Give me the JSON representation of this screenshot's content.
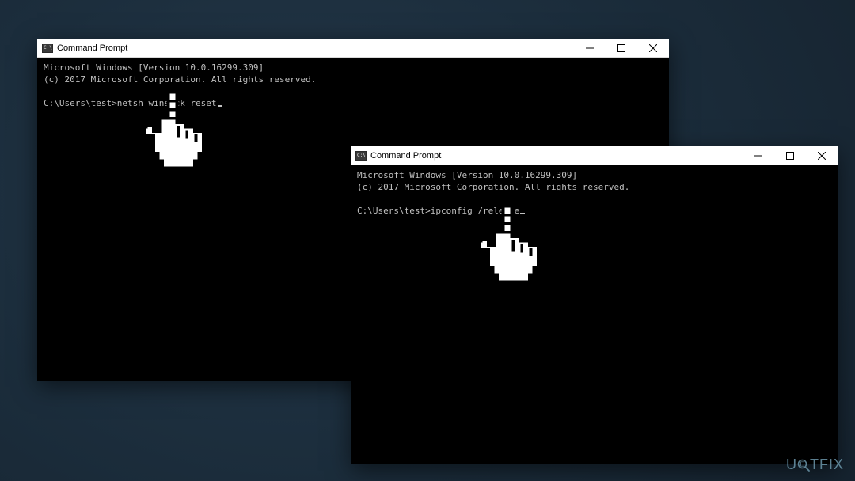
{
  "background": {
    "watermark_prefix": "U",
    "watermark_mid": "G",
    "watermark_suffix": "TFIX"
  },
  "windows": {
    "back": {
      "title": "Command Prompt",
      "output": {
        "line1": "Microsoft Windows [Version 10.0.16299.309]",
        "line2": "(c) 2017 Microsoft Corporation. All rights reserved."
      },
      "prompt": "C:\\Users\\test>",
      "command": "netsh winsock reset"
    },
    "front": {
      "title": "Command Prompt",
      "output": {
        "line1": "Microsoft Windows [Version 10.0.16299.309]",
        "line2": "(c) 2017 Microsoft Corporation. All rights reserved."
      },
      "prompt": "C:\\Users\\test>",
      "command": "ipconfig /release"
    }
  }
}
